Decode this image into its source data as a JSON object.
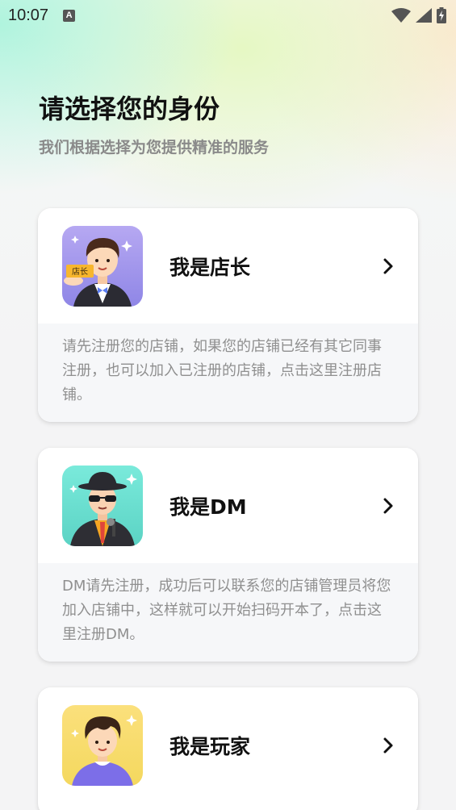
{
  "status_bar": {
    "time": "10:07",
    "notification_icon": "a-box-icon",
    "icons": [
      "wifi-icon",
      "signal-icon",
      "battery-charging-icon"
    ]
  },
  "header": {
    "title": "请选择您的身份",
    "subtitle": "我们根据选择为您提供精准的服务"
  },
  "roles": [
    {
      "label": "我是店长",
      "badge": "店长",
      "description": "请先注册您的店铺，如果您的店铺已经有其它同事注册，也可以加入已注册的店铺，点击这里注册店铺。",
      "avatar_bg": "#a9a3ee"
    },
    {
      "label": "我是DM",
      "description": "DM请先注册，成功后可以联系您的店铺管理员将您加入店铺中，这样就可以开始扫码开本了，点击这里注册DM。",
      "avatar_bg": "#6fe0d0"
    },
    {
      "label": "我是玩家",
      "avatar_bg": "#f7e27a"
    }
  ]
}
